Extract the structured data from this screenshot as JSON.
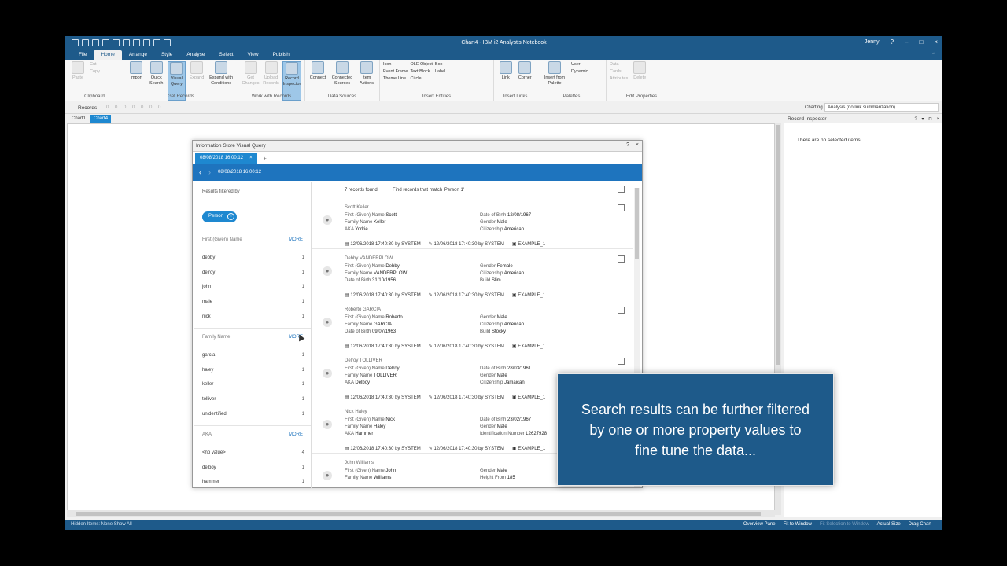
{
  "window": {
    "title": "Chart4 - IBM i2 Analyst's Notebook",
    "user": "Jenny",
    "controls": [
      "?",
      "–",
      "□",
      "×"
    ]
  },
  "ribbon_tabs": [
    "File",
    "Home",
    "Arrange",
    "Style",
    "Analyse",
    "Select",
    "View",
    "Publish"
  ],
  "ribbon": {
    "clipboard": {
      "name": "Clipboard",
      "paste": "Paste",
      "cut": "Cut",
      "copy": "Copy"
    },
    "get_records": {
      "name": "Get Records",
      "import": "Import",
      "quick_search": "Quick Search",
      "visual_query": "Visual Query",
      "expand": "Expand",
      "expand_conditions": "Expand with Conditions"
    },
    "work_with_records": {
      "name": "Work with Records",
      "get_changes": "Get Changes",
      "upload_records": "Upload Records",
      "record_inspector": "Record Inspector"
    },
    "data_sources": {
      "name": "Data Sources",
      "connect": "Connect",
      "connected_sources": "Connected Sources",
      "item_actions": "Item Actions"
    },
    "insert_entities": {
      "name": "Insert Entities",
      "icon": "Icon",
      "event_frame": "Event Frame",
      "theme_line": "Theme Line",
      "ole_object": "OLE Object",
      "text_block": "Text Block",
      "circle": "Circle",
      "box": "Box",
      "label": "Label"
    },
    "insert_links": {
      "name": "Insert Links",
      "link": "Link",
      "corner": "Corner"
    },
    "palettes": {
      "name": "Palettes",
      "insert_from_palette": "Insert from Palette",
      "user": "User",
      "dynamic": "Dynamic"
    },
    "edit_properties": {
      "name": "Edit Properties",
      "data": "Data",
      "cards": "Cards",
      "attributes": "Attributes",
      "delete": "Delete"
    }
  },
  "records_bar": {
    "label": "Records",
    "counts": "0  0  0  0  0  0  0",
    "charting_scheme_label": "Charting scheme:",
    "charting_scheme_value": "Analysis (no link summarization)"
  },
  "doc_tabs": [
    "Chart1",
    "Chart4"
  ],
  "inspector": {
    "title": "Record Inspector",
    "empty": "There are no selected items."
  },
  "status": {
    "left": "Hidden Items: None   Show All",
    "overview": "Overview Pane",
    "fit_window": "Fit to Window",
    "fit_selection": "Fit Selection to Window",
    "actual_size": "Actual Size",
    "drag_chart": "Drag Chart"
  },
  "vq": {
    "title": "Information Store Visual Query",
    "tab": "08/08/2018 16:00:12",
    "nav_title": "08/08/2018 16:00:12",
    "filtered_by": "Results filtered by",
    "chip": "Person",
    "more": "MORE",
    "groups": [
      {
        "title": "First (Given) Name",
        "values": [
          {
            "v": "debby",
            "c": "1"
          },
          {
            "v": "delroy",
            "c": "1"
          },
          {
            "v": "john",
            "c": "1"
          },
          {
            "v": "male",
            "c": "1"
          },
          {
            "v": "nick",
            "c": "1"
          }
        ]
      },
      {
        "title": "Family Name",
        "values": [
          {
            "v": "garcia",
            "c": "1"
          },
          {
            "v": "haley",
            "c": "1"
          },
          {
            "v": "keller",
            "c": "1"
          },
          {
            "v": "tolliver",
            "c": "1"
          },
          {
            "v": "unidentified",
            "c": "1"
          }
        ]
      },
      {
        "title": "AKA",
        "values": [
          {
            "v": "<no value>",
            "c": "4"
          },
          {
            "v": "delboy",
            "c": "1"
          },
          {
            "v": "hammer",
            "c": "1"
          }
        ]
      }
    ],
    "records_found": "7 records found",
    "match_text": "Find records that match 'Person 1'",
    "records": [
      {
        "name": "Scott Keller",
        "left": [
          [
            "First (Given) Name",
            "Scott"
          ],
          [
            "Family Name",
            "Keller"
          ],
          [
            "AKA",
            "Yorkie"
          ]
        ],
        "right": [
          [
            "Date of Birth",
            "12/08/1967"
          ],
          [
            "Gender",
            "Male"
          ],
          [
            "Citizenship",
            "American"
          ]
        ],
        "created": "12/06/2018 17:40:30 by SYSTEM",
        "edited": "12/06/2018 17:40:30 by SYSTEM",
        "source": "EXAMPLE_1"
      },
      {
        "name": "Debby VANDERPLOW",
        "left": [
          [
            "First (Given) Name",
            "Debby"
          ],
          [
            "Family Name",
            "VANDERPLOW"
          ],
          [
            "Date of Birth",
            "31/10/1956"
          ]
        ],
        "right": [
          [
            "Gender",
            "Female"
          ],
          [
            "Citizenship",
            "American"
          ],
          [
            "Build",
            "Slim"
          ]
        ],
        "created": "12/06/2018 17:40:30 by SYSTEM",
        "edited": "12/06/2018 17:40:30 by SYSTEM",
        "source": "EXAMPLE_1"
      },
      {
        "name": "Roberto GARCIA",
        "left": [
          [
            "First (Given) Name",
            "Roberto"
          ],
          [
            "Family Name",
            "GARCIA"
          ],
          [
            "Date of Birth",
            "09/07/1963"
          ]
        ],
        "right": [
          [
            "Gender",
            "Male"
          ],
          [
            "Citizenship",
            "American"
          ],
          [
            "Build",
            "Stocky"
          ]
        ],
        "created": "12/06/2018 17:40:30 by SYSTEM",
        "edited": "12/06/2018 17:40:30 by SYSTEM",
        "source": "EXAMPLE_1"
      },
      {
        "name": "Delroy TOLLIVER",
        "left": [
          [
            "First (Given) Name",
            "Delroy"
          ],
          [
            "Family Name",
            "TOLLIVER"
          ],
          [
            "AKA",
            "Delboy"
          ]
        ],
        "right": [
          [
            "Date of Birth",
            "28/03/1961"
          ],
          [
            "Gender",
            "Male"
          ],
          [
            "Citizenship",
            "Jamaican"
          ]
        ],
        "created": "12/06/2018 17:40:30 by SYSTEM",
        "edited": "12/06/2018 17:40:30 by SYSTEM",
        "source": "EXAMPLE_1"
      },
      {
        "name": "Nick Haley",
        "left": [
          [
            "First (Given) Name",
            "Nick"
          ],
          [
            "Family Name",
            "Haley"
          ],
          [
            "AKA",
            "Hammer"
          ]
        ],
        "right": [
          [
            "Date of Birth",
            "23/02/1967"
          ],
          [
            "Gender",
            "Male"
          ],
          [
            "Identification Number",
            "L2627928"
          ]
        ],
        "created": "12/06/2018 17:40:30 by SYSTEM",
        "edited": "12/06/2018 17:40:30 by SYSTEM",
        "source": "EXAMPLE_1"
      },
      {
        "name": "John Williams",
        "left": [
          [
            "First (Given) Name",
            "John"
          ],
          [
            "Family Name",
            "Williams"
          ]
        ],
        "right": [
          [
            "Gender",
            "Male"
          ],
          [
            "Height From",
            "185"
          ]
        ],
        "created": "",
        "edited": "",
        "source": ""
      }
    ]
  },
  "callout": {
    "line1": "Search results can be further filtered",
    "line2": "by one or more property values to",
    "line3": "fine tune the data..."
  }
}
